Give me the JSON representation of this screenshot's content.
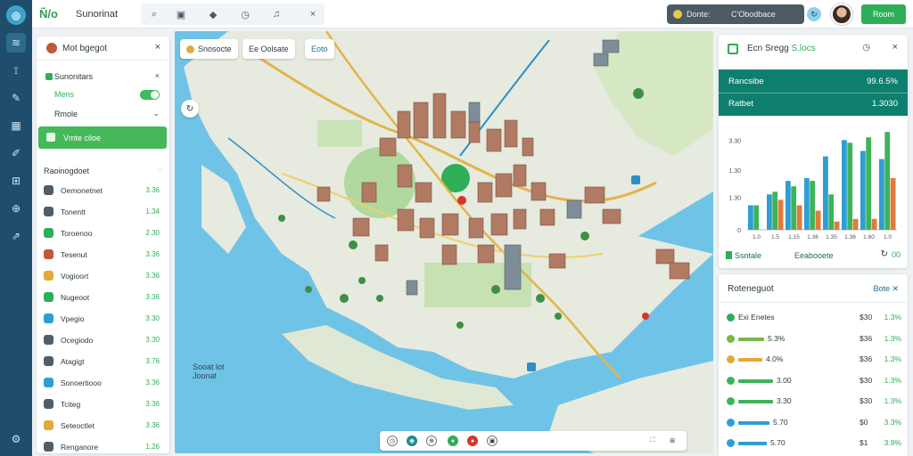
{
  "topbar": {
    "brand": "Ñ/o",
    "title": "Sunorinat",
    "status_left": "Donte:",
    "status_right": "C'Obodbace",
    "primary_button": "Room"
  },
  "left_panel": {
    "title": "Mot bgegot",
    "rows": [
      {
        "label": "Sunonitars"
      },
      {
        "label": "Mens"
      },
      {
        "label": "Rmole"
      }
    ],
    "action_button": "Vmte ciloe",
    "section_title": "Raoinogdoet",
    "layers": [
      {
        "name": "Oemonetnet",
        "value": "3.36"
      },
      {
        "name": "Tonentt",
        "value": "1.34"
      },
      {
        "name": "Toroenoo",
        "value": "2.30"
      },
      {
        "name": "Tesenut",
        "value": "3.36"
      },
      {
        "name": "Vogioort",
        "value": "3.36"
      },
      {
        "name": "Nugeoot",
        "value": "3.36"
      },
      {
        "name": "Vpegio",
        "value": "3.30"
      },
      {
        "name": "Ocegiodo",
        "value": "3.30"
      },
      {
        "name": "Atagigt",
        "value": "3.76"
      },
      {
        "name": "Sonoertiooo",
        "value": "3.36"
      },
      {
        "name": "Tciteg",
        "value": "3.36"
      },
      {
        "name": "Seteoctlet",
        "value": "3.36"
      },
      {
        "name": "Renganore",
        "value": "1.26"
      }
    ]
  },
  "map": {
    "chips": [
      "Snosocte",
      "Ee Oolsate",
      "Eoto"
    ],
    "labels": [
      {
        "text": "Sooat lot\nJoonat"
      }
    ]
  },
  "stats_panel": {
    "title_prefix": "Ecn Sregg",
    "title_suffix": "S.locs",
    "kpis": [
      {
        "label": "Rancsibe",
        "value": "99.6.5%"
      },
      {
        "label": "Ratbet",
        "value": "1.3030"
      }
    ],
    "y_ticks": [
      "3.30",
      "1.30",
      "1.30",
      "0"
    ],
    "footer_left": "Ssntale",
    "footer_mid": "Eeabooete",
    "footer_right": "00"
  },
  "chart_data": {
    "type": "bar",
    "categories": [
      "1.0",
      "1.5",
      "1.15",
      "1.36",
      "1.35",
      "1.36",
      "1.60",
      "1.0"
    ],
    "ylim": [
      0,
      3.8
    ],
    "y_ticks": [
      "3.30",
      "1.30",
      "1.30",
      "0"
    ],
    "series": [
      {
        "values": [
          0.9,
          1.3,
          1.8,
          1.9,
          2.7,
          3.3,
          2.9,
          2.6
        ],
        "color": "#2d9fd3"
      },
      {
        "values": [
          0.9,
          1.4,
          1.6,
          1.8,
          1.3,
          3.2,
          3.4,
          3.6
        ],
        "color": "#3fb35a"
      },
      {
        "values": [
          0.0,
          1.1,
          0.9,
          0.7,
          0.3,
          0.4,
          0.4,
          1.9
        ],
        "color": "#e07b3b"
      }
    ]
  },
  "table_panel": {
    "title": "Roteneguot",
    "action": "Bote",
    "rows": [
      {
        "label": "Exi Enetes",
        "v1": "$30",
        "v2": "1.3%",
        "bar_pct": 0,
        "color": "#2eae58"
      },
      {
        "label": "5.3%",
        "v1": "$36",
        "v2": "1.3%",
        "bar_pct": 42,
        "color": "#79b84a"
      },
      {
        "label": "4.0%",
        "v1": "$36",
        "v2": "1.3%",
        "bar_pct": 38,
        "color": "#e2a93a"
      },
      {
        "label": "3.00",
        "v1": "$30",
        "v2": "1.3%",
        "bar_pct": 55,
        "color": "#3fb35a"
      },
      {
        "label": "3.30",
        "v1": "$30",
        "v2": "1.3%",
        "bar_pct": 55,
        "color": "#3fb35a"
      },
      {
        "label": "5.70",
        "v1": "$0",
        "v2": "3.3%",
        "bar_pct": 50,
        "color": "#2d9fd3"
      },
      {
        "label": "5.70",
        "v1": "$1",
        "v2": "3.9%",
        "bar_pct": 45,
        "color": "#2d9fd3"
      }
    ]
  }
}
